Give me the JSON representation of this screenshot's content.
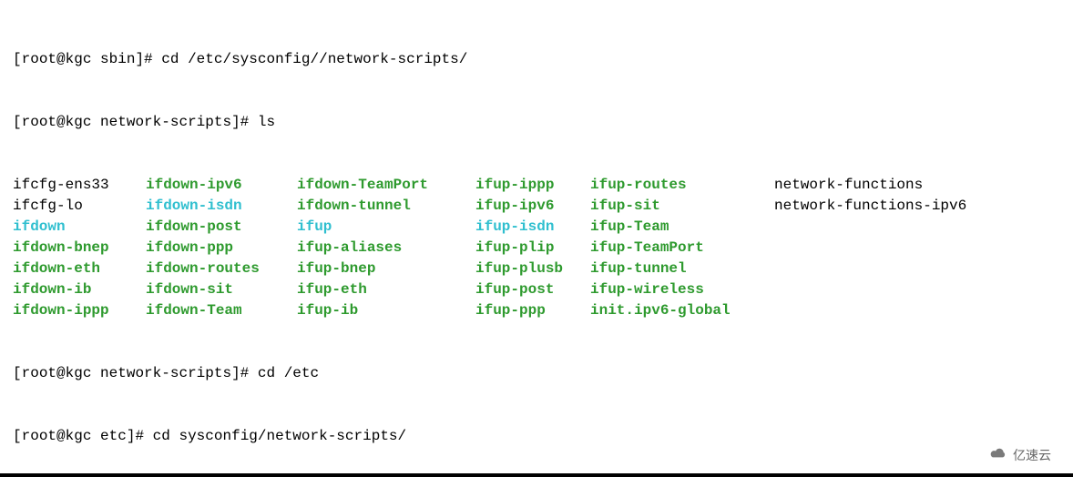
{
  "prompt1": {
    "user": "root",
    "host": "kgc",
    "dir": "sbin",
    "cmd": "cd /etc/sysconfig//network-scripts/"
  },
  "prompt2": {
    "user": "root",
    "host": "kgc",
    "dir": "network-scripts",
    "cmd": "ls"
  },
  "listing": {
    "col1": [
      {
        "name": "ifcfg-ens33",
        "cls": "black"
      },
      {
        "name": "ifcfg-lo",
        "cls": "black"
      },
      {
        "name": "ifdown",
        "cls": "cyan"
      },
      {
        "name": "ifdown-bnep",
        "cls": "green"
      },
      {
        "name": "ifdown-eth",
        "cls": "green"
      },
      {
        "name": "ifdown-ib",
        "cls": "green"
      },
      {
        "name": "ifdown-ippp",
        "cls": "green"
      }
    ],
    "col2": [
      {
        "name": "ifdown-ipv6",
        "cls": "green"
      },
      {
        "name": "ifdown-isdn",
        "cls": "cyan"
      },
      {
        "name": "ifdown-post",
        "cls": "green"
      },
      {
        "name": "ifdown-ppp",
        "cls": "green"
      },
      {
        "name": "ifdown-routes",
        "cls": "green"
      },
      {
        "name": "ifdown-sit",
        "cls": "green"
      },
      {
        "name": "ifdown-Team",
        "cls": "green"
      }
    ],
    "col3": [
      {
        "name": "ifdown-TeamPort",
        "cls": "green"
      },
      {
        "name": "ifdown-tunnel",
        "cls": "green"
      },
      {
        "name": "ifup",
        "cls": "cyan"
      },
      {
        "name": "ifup-aliases",
        "cls": "green"
      },
      {
        "name": "ifup-bnep",
        "cls": "green"
      },
      {
        "name": "ifup-eth",
        "cls": "green"
      },
      {
        "name": "ifup-ib",
        "cls": "green"
      }
    ],
    "col4": [
      {
        "name": "ifup-ippp",
        "cls": "green"
      },
      {
        "name": "ifup-ipv6",
        "cls": "green"
      },
      {
        "name": "ifup-isdn",
        "cls": "cyan"
      },
      {
        "name": "ifup-plip",
        "cls": "green"
      },
      {
        "name": "ifup-plusb",
        "cls": "green"
      },
      {
        "name": "ifup-post",
        "cls": "green"
      },
      {
        "name": "ifup-ppp",
        "cls": "green"
      }
    ],
    "col5": [
      {
        "name": "ifup-routes",
        "cls": "green"
      },
      {
        "name": "ifup-sit",
        "cls": "green"
      },
      {
        "name": "ifup-Team",
        "cls": "green"
      },
      {
        "name": "ifup-TeamPort",
        "cls": "green"
      },
      {
        "name": "ifup-tunnel",
        "cls": "green"
      },
      {
        "name": "ifup-wireless",
        "cls": "green"
      },
      {
        "name": "init.ipv6-global",
        "cls": "green"
      }
    ],
    "col6": [
      {
        "name": "network-functions",
        "cls": "black"
      },
      {
        "name": "network-functions-ipv6",
        "cls": "black"
      }
    ]
  },
  "prompt3": {
    "user": "root",
    "host": "kgc",
    "dir": "network-scripts",
    "cmd": "cd /etc"
  },
  "prompt4": {
    "user": "root",
    "host": "kgc",
    "dir": "etc",
    "cmd": "cd sysconfig/network-scripts/"
  },
  "watermark": "亿速云"
}
